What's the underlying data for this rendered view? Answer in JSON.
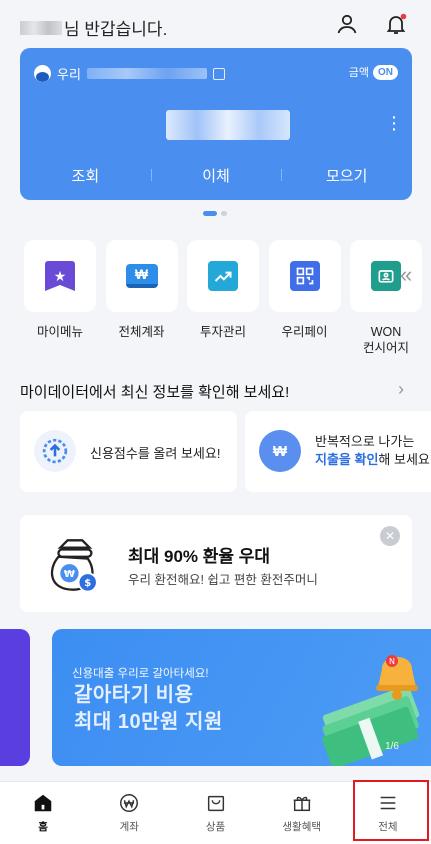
{
  "header": {
    "greeting": "님 반갑습니다.",
    "profile_icon": "person-icon",
    "notification_icon": "bell-icon"
  },
  "account_card": {
    "bank_name": "우리",
    "amount_label": "금액",
    "amount_toggle": "ON",
    "actions": [
      "조회",
      "이체",
      "모으기"
    ]
  },
  "quick_menu": [
    {
      "label": "마이메뉴",
      "icon": "bookmark-star-icon",
      "color": "#6a4bd6"
    },
    {
      "label": "전체계좌",
      "icon": "won-card-icon",
      "color": "#2e8de8"
    },
    {
      "label": "투자관리",
      "icon": "chart-up-icon",
      "color": "#23a8d8"
    },
    {
      "label": "우리페이",
      "icon": "qr-icon",
      "color": "#3f6ee8"
    },
    {
      "label": "WON\n컨시어지",
      "icon": "concierge-icon",
      "color": "#1f9e8e"
    }
  ],
  "mydata": {
    "title": "마이데이터에서 최신 정보를 확인해 보세요!",
    "card1_text": "신용점수를 올려 보세요!",
    "card2_line1": "반복적으로 나가는",
    "card2_highlight": "지출을 확인",
    "card2_rest": "해 보세요!"
  },
  "exchange_banner": {
    "title": "최대 90% 환율 우대",
    "subtitle": "우리 환전해요! 쉽고 편한 환전주머니"
  },
  "promo": {
    "small": "신용대출 우리로 갈아타세요!",
    "line1": "갈아타기 비용",
    "line2": "최대 10만원 지원",
    "page": "1/6"
  },
  "bottom_nav": [
    {
      "label": "홈",
      "icon": "home-icon",
      "active": true
    },
    {
      "label": "계좌",
      "icon": "won-circle-icon",
      "active": false
    },
    {
      "label": "상품",
      "icon": "shopping-bag-icon",
      "active": false
    },
    {
      "label": "생활혜택",
      "icon": "gift-icon",
      "active": false
    },
    {
      "label": "전체",
      "icon": "menu-icon",
      "active": false
    }
  ]
}
